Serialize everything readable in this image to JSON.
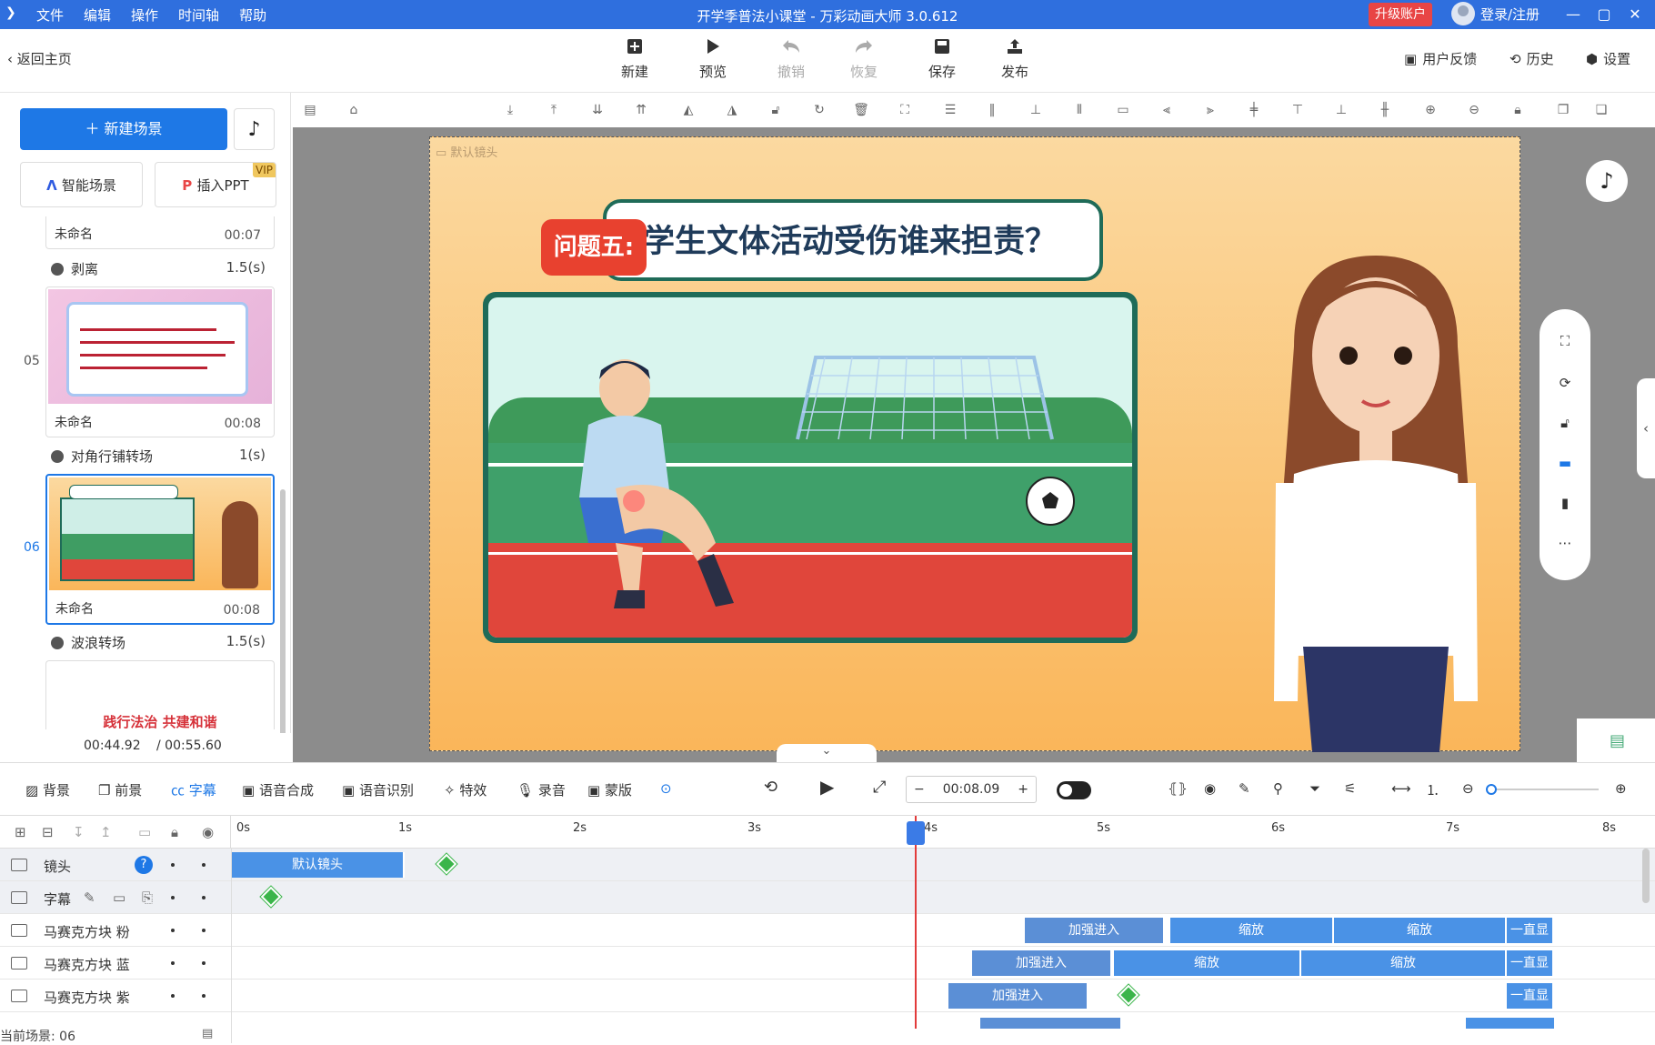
{
  "titlebar": {
    "menu": [
      "文件",
      "编辑",
      "操作",
      "时间轴",
      "帮助"
    ],
    "title": "开学季普法小课堂 - 万彩动画大师 3.0.612",
    "upgrade": "升级账户",
    "login": "登录/注册"
  },
  "toolbar": {
    "back": "返回主页",
    "buttons": [
      {
        "label": "新建",
        "icon": "plus-box-icon",
        "enabled": true
      },
      {
        "label": "预览",
        "icon": "play-icon",
        "enabled": true
      },
      {
        "label": "撤销",
        "icon": "undo-icon",
        "enabled": false
      },
      {
        "label": "恢复",
        "icon": "redo-icon",
        "enabled": false
      },
      {
        "label": "保存",
        "icon": "save-icon",
        "enabled": true
      },
      {
        "label": "发布",
        "icon": "publish-icon",
        "enabled": true
      }
    ],
    "feedback": "用户反馈",
    "history": "历史",
    "settings": "设置"
  },
  "left": {
    "new_scene": "新建场景",
    "smart_scene": "智能场景",
    "insert_ppt": "插入PPT",
    "vip": "VIP",
    "scenes": [
      {
        "num": "",
        "name": "未命名",
        "time": "00:07"
      },
      {
        "num": "05",
        "name": "未命名",
        "time": "00:08"
      },
      {
        "num": "06",
        "name": "未命名",
        "time": "00:08"
      }
    ],
    "transitions": [
      {
        "name": "剥离",
        "dur": "1.5(s)"
      },
      {
        "name": "对角行铺转场",
        "dur": "1(s)"
      },
      {
        "name": "波浪转场",
        "dur": "1.5(s)"
      }
    ],
    "next_preview_text": "践行法治  共建和谐",
    "time_current": "00:44.92",
    "time_total": "/ 00:55.60"
  },
  "stage": {
    "camera_label": "默认镜头",
    "badge": "问题五:",
    "headline": "学生文体活动受伤谁来担责？"
  },
  "timeline_tools": {
    "items": [
      "背景",
      "前景",
      "字幕",
      "语音合成",
      "语音识别",
      "特效",
      "录音",
      "蒙版"
    ],
    "active": "字幕",
    "timecode": "00:08.09"
  },
  "timeline": {
    "ticks": [
      "0s",
      "1s",
      "2s",
      "3s",
      "4s",
      "5s",
      "6s",
      "7s",
      "8s"
    ],
    "rows": [
      {
        "label": "镜头",
        "clips": [
          {
            "text": "默认镜头"
          }
        ]
      },
      {
        "label": "字幕",
        "clips": []
      },
      {
        "label": "马赛克方块 粉",
        "clips": [
          {
            "text": "加强进入"
          },
          {
            "text": "缩放"
          },
          {
            "text": "缩放"
          },
          {
            "text": "一直显"
          }
        ]
      },
      {
        "label": "马赛克方块 蓝",
        "clips": [
          {
            "text": "加强进入"
          },
          {
            "text": "缩放"
          },
          {
            "text": "缩放"
          },
          {
            "text": "一直显"
          }
        ]
      },
      {
        "label": "马赛克方块 紫",
        "clips": [
          {
            "text": "加强进入"
          },
          {
            "text": "一直显"
          }
        ]
      }
    ],
    "status": "当前场景: 06"
  },
  "colors": {
    "primary": "#2f6fde",
    "accent": "#1e78e6",
    "danger": "#e84545",
    "playhead": "#e23b3b"
  }
}
